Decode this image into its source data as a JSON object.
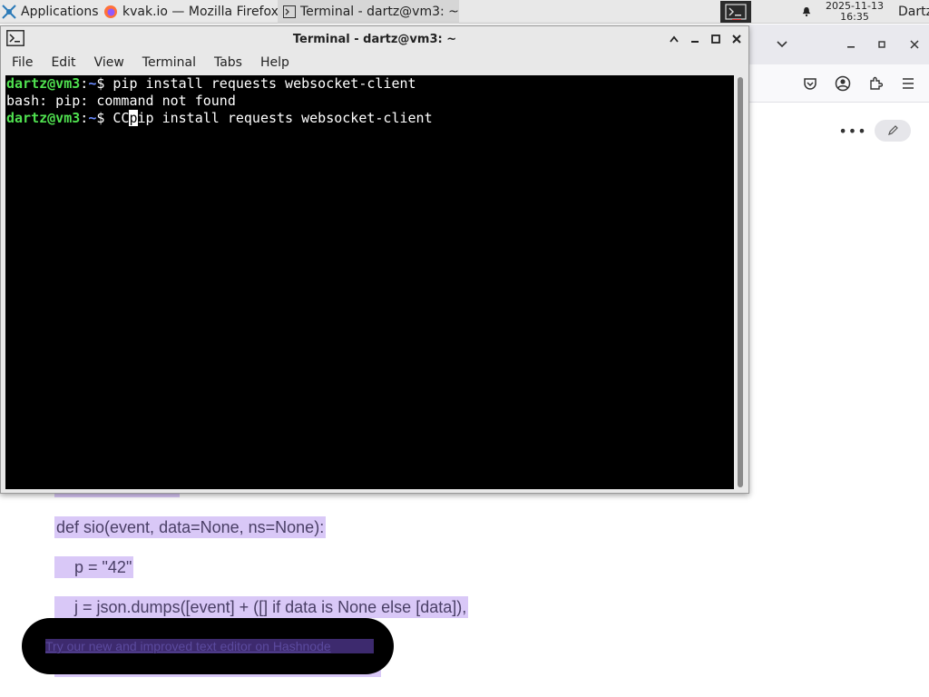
{
  "taskbar": {
    "applications_label": "Applications",
    "applications_suffix": "☰",
    "firefox_task": "kvak.io — Mozilla Firefox",
    "terminal_task": "Terminal - dartz@vm3: ~",
    "clock_date": "2025-11-13",
    "clock_time": "16:35",
    "user": "Dartz"
  },
  "terminal": {
    "title": "Terminal - dartz@vm3: ~",
    "menu": [
      "File",
      "Edit",
      "View",
      "Terminal",
      "Tabs",
      "Help"
    ],
    "lines": [
      {
        "user": "dartz@vm3",
        "sep": ":",
        "path": "~",
        "symbol": "$ ",
        "cmd": "pip install requests websocket-client"
      },
      {
        "text": "bash: pip: command not found"
      },
      {
        "user": "dartz@vm3",
        "sep": ":",
        "path": "~",
        "symbol": "$ ",
        "cmd_before": "CC",
        "cursor_char": "p",
        "cmd_after": "ip install requests websocket-client"
      }
    ]
  },
  "webpage": {
    "code_lines": [
      "def sio(event, data=None, ns=None):",
      "    p = \"42\"",
      "    j = json.dumps([event] + ([] if data is None else [data]),"
    ],
    "toast_text": "Try our new and improved text editor on Hashnode"
  },
  "colors": {
    "prompt_user": "#4fe04f",
    "prompt_path": "#6c8cff",
    "highlight": "#d9c8f7"
  }
}
